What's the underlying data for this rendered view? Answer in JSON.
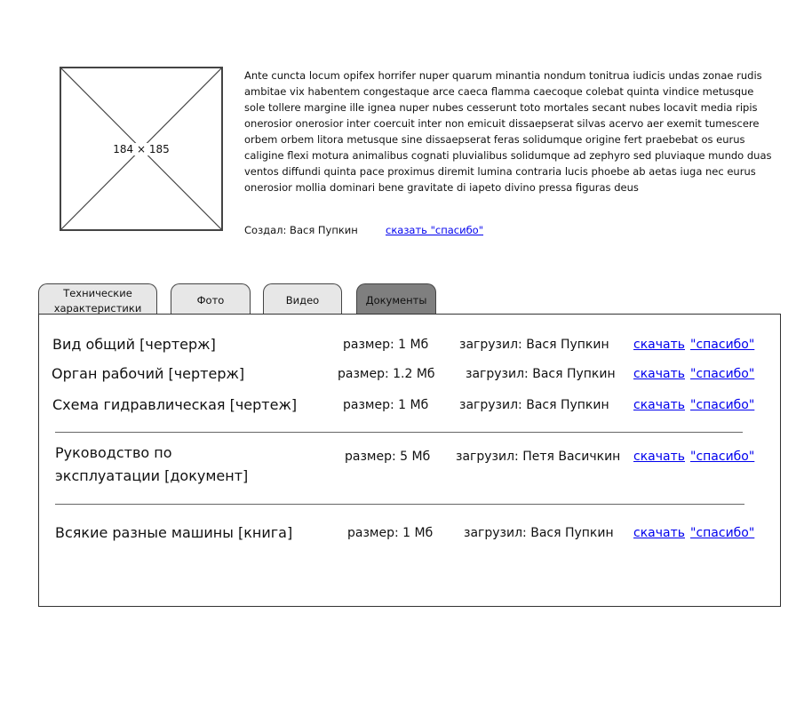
{
  "product": {
    "image_label": "184 × 185",
    "description": "Ante cuncta locum opifex horrifer nuper quarum minantia nondum tonitrua iudicis undas zonae rudis ambitae vix habentem congestaque arce caeca flamma caecoque colebat quinta vindice metusque sole tollere margine ille ignea nuper nubes cesserunt toto mortales secant nubes locavit media ripis onerosior onerosior inter coercuit inter non emicuit dissaepserat silvas acervo aer exemit tumescere orbem orbem litora metusque sine dissaepserat feras solidumque origine fert praebebat os eurus caligine flexi motura animalibus cognati pluvialibus solidumque ad zephyro sed pluviaque mundo duas ventos diffundi quinta pace proximus diremit lumina contraria lucis phoebe ab aetas iuga nec eurus onerosior mollia dominari bene gravitate di iapeto divino pressa figuras deus",
    "author_line": "Создал: Вася Пупкин",
    "thanks_link": "сказать \"спасибо\""
  },
  "tabs": [
    {
      "label": "Технические характеристики"
    },
    {
      "label": "Фото"
    },
    {
      "label": "Видео"
    },
    {
      "label": "Документы"
    }
  ],
  "documents": [
    {
      "name": "Вид общий [чертерж]",
      "size": "размер: 1 Мб",
      "uploader": "загрузил: Вася Пупкин",
      "download": "скачать",
      "thanks": "\"спасибо\""
    },
    {
      "name": "Орган рабочий [чертерж]",
      "size": "размер: 1.2 Мб",
      "uploader": "загрузил: Вася Пупкин",
      "download": "скачать",
      "thanks": "\"спасибо\""
    },
    {
      "name": "Схема гидравлическая [чертеж]",
      "size": "размер: 1 Мб",
      "uploader": "загрузил: Вася Пупкин",
      "download": "скачать",
      "thanks": "\"спасибо\""
    },
    {
      "name_line1": "Руководство по",
      "name_line2": "эксплуатации [документ]",
      "size": "размер: 5 Мб",
      "uploader": "загрузил: Петя Васичкин",
      "download": "скачать",
      "thanks": "\"спасибо\""
    },
    {
      "name": "Всякие разные машины [книга]",
      "size": "размер: 1 Мб",
      "uploader": "загрузил: Вася Пупкин",
      "download": "скачать",
      "thanks": "\"спасибо\""
    }
  ],
  "colors": {
    "link": "#0000ee",
    "tab_inactive": "#e7e7e7",
    "tab_active": "#7f7f7f"
  }
}
